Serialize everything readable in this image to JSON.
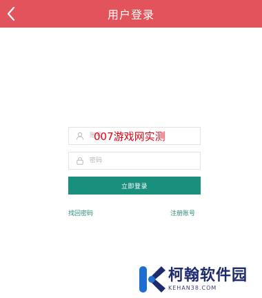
{
  "header": {
    "title": "用户登录",
    "back_icon": "chevron-left-icon",
    "color": "#e2535c"
  },
  "form": {
    "username": {
      "placeholder": "账号",
      "value": "",
      "icon": "user-icon"
    },
    "password": {
      "placeholder": "密码",
      "value": "",
      "icon": "lock-icon"
    },
    "login_label": "立即登录",
    "login_color": "#19907e"
  },
  "links": {
    "forgot_password": "找回密码",
    "register": "注册账号"
  },
  "overlay": {
    "watermark_text": "007游戏网实测"
  },
  "site_logo": {
    "name_cn": "柯翰软件园",
    "name_en": "KEHAN38.COM"
  }
}
